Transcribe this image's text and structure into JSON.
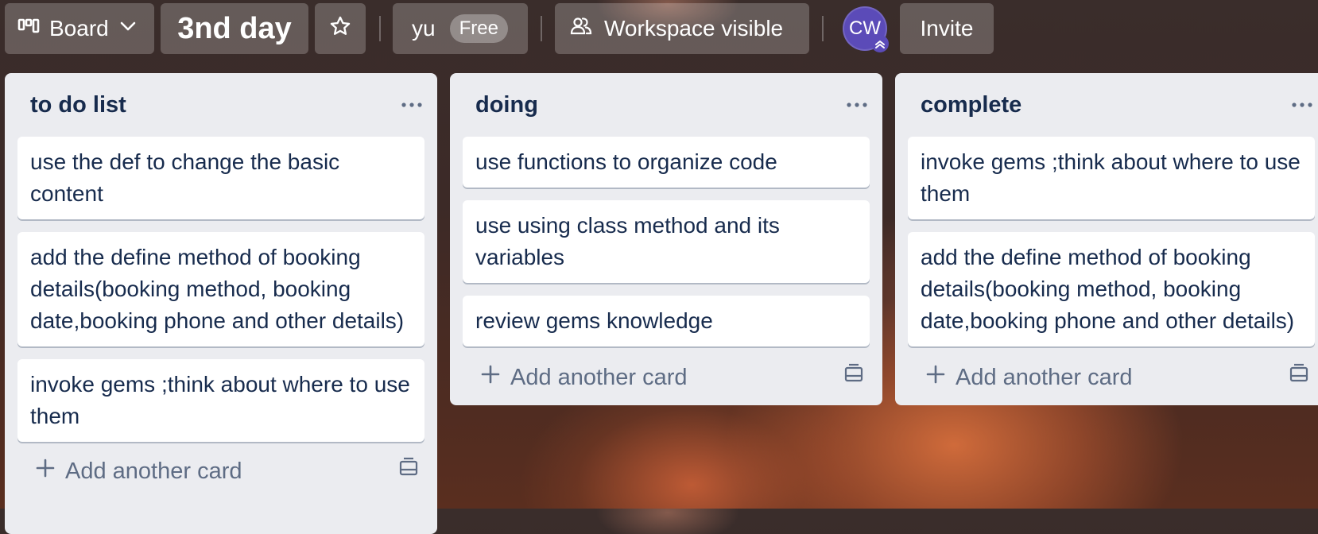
{
  "header": {
    "view_label": "Board",
    "board_title": "3nd day",
    "workspace_name": "yu",
    "plan_badge": "Free",
    "visibility_label": "Workspace visible",
    "avatar_initials": "CW",
    "invite_label": "Invite"
  },
  "lists": [
    {
      "title": "to do list",
      "cards": [
        "use the def to change the basic content",
        "add the define method of booking details(booking method, booking date,booking phone and other details)",
        "invoke gems ;think about where to use them"
      ],
      "add_label": "Add another card"
    },
    {
      "title": "doing",
      "cards": [
        "use functions to organize code",
        "use using class method and its variables",
        "review gems knowledge"
      ],
      "add_label": "Add another card"
    },
    {
      "title": "complete",
      "cards": [
        "invoke gems ;think about where to use them",
        "add the define method of booking details(booking method, booking date,booking phone and other details)"
      ],
      "add_label": "Add another card"
    }
  ],
  "icons": {
    "view": "board-columns-icon",
    "view_toggle": "chevron-down-icon",
    "star": "star-icon",
    "visibility": "people-icon",
    "list_menu": "ellipsis-icon",
    "add": "plus-icon",
    "template": "card-template-icon"
  },
  "colors": {
    "avatar_bg": "#5b4bb8",
    "list_bg": "#ebecf0",
    "card_text": "#172b4d",
    "muted_text": "#5e6c84"
  }
}
